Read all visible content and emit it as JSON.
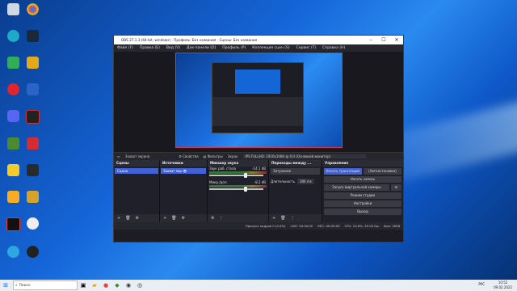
{
  "obs": {
    "title": "OBS 27.1.3 (64-bit, windows) - Профиль: Без названия - Сцены: Без названия",
    "menu": [
      "Файл (F)",
      "Правка (E)",
      "Вид (V)",
      "Док-панели (D)",
      "Профиль (P)",
      "Коллекция сцен (S)",
      "Сервис (T)",
      "Справка (H)"
    ],
    "controls": {
      "source_label": "Захват экрана",
      "properties": "Свойства",
      "filters": "Фильтры",
      "screen_label": "Экран",
      "screen_value": "IPS FULLHD: 1920x1080 @ 0,0 (Основной монитор)"
    },
    "docks": {
      "scenes": {
        "title": "Сцены",
        "items": [
          "Сцена"
        ]
      },
      "sources": {
        "title": "Источники",
        "items": [
          "Захват экр"
        ]
      },
      "mixer": {
        "title": "Микшер звука",
        "channels": [
          {
            "name": "Звук раб. стола",
            "db": "-14.1 dB"
          },
          {
            "name": "Микр./доп.",
            "db": "-8.2 dB"
          }
        ]
      },
      "transitions": {
        "title": "Переходы между ...",
        "type": "Затухание",
        "duration_label": "Длительность",
        "duration_value": "300 ms"
      },
      "controls": {
        "title": "Управление",
        "start_stream": "Начать трансляцию",
        "autostart": "(Автоостановка)",
        "start_record": "Начать запись",
        "virtual_cam": "Запуск виртуальной камеры",
        "studio_mode": "Режим студии",
        "settings": "Настройки",
        "exit": "Выход"
      }
    },
    "status": {
      "dropped": "Пропуск кадров 0 (0.0%)",
      "live": "LIVE: 00:00:00",
      "rec": "REC: 00:00:00",
      "cpu": "CPU: 10.8%, 30.00 fps",
      "kbps": "kb/s: 2608"
    }
  },
  "taskbar": {
    "search_placeholder": "Поиск",
    "time": "10:52",
    "date": "09.02.2022",
    "lang": "РУС"
  },
  "icons": {
    "desktop": [
      "recycle-bin",
      "chrome",
      "edge",
      "steam",
      "network",
      "csgo",
      "opera",
      "app-1",
      "discord",
      "app-2",
      "minecraft",
      "app-3",
      "app-4",
      "app-5",
      "rockstar",
      "app-6",
      "app-7",
      "app-8",
      "telegram",
      "app-9"
    ]
  }
}
